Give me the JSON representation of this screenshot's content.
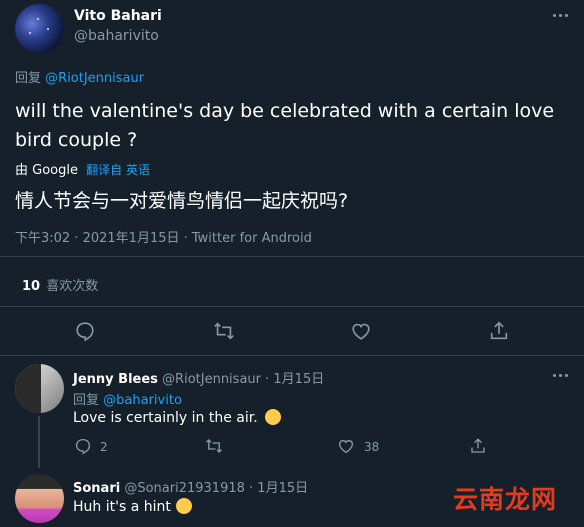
{
  "main_tweet": {
    "display_name": "Vito Bahari",
    "handle": "@baharivito",
    "reply_prefix": "回复",
    "reply_to": "@RiotJennisaur",
    "text_line1": "will the valentine's day be celebrated with a certain love",
    "text_line2": "bird couple ?",
    "translate_by": "由 Google",
    "translate_from": "翻译自 英语",
    "translated_text": "情人节会与一对爱情鸟情侣一起庆祝吗?",
    "meta": "下午3:02 · 2021年1月15日 · Twitter for Android",
    "likes_count": "10",
    "likes_label": "喜欢次数"
  },
  "replies": [
    {
      "display_name": "Jenny Blees",
      "handle": "@RiotJennisaur",
      "date": "· 1月15日",
      "reply_prefix": "回复",
      "reply_to": "@baharivito",
      "text": "Love is certainly in the air.",
      "reply_count": "2",
      "like_count": "38"
    },
    {
      "display_name": "Sonari",
      "handle": "@Sonari21931918",
      "date": "· 1月15日",
      "text": "Huh it's a hint"
    }
  ],
  "watermark": {
    "text": "云南龙网",
    "color": "#e23b1e"
  },
  "colors": {
    "background": "#15202b",
    "muted": "#8899a6",
    "link": "#1da1f2",
    "divider": "#38444d"
  }
}
